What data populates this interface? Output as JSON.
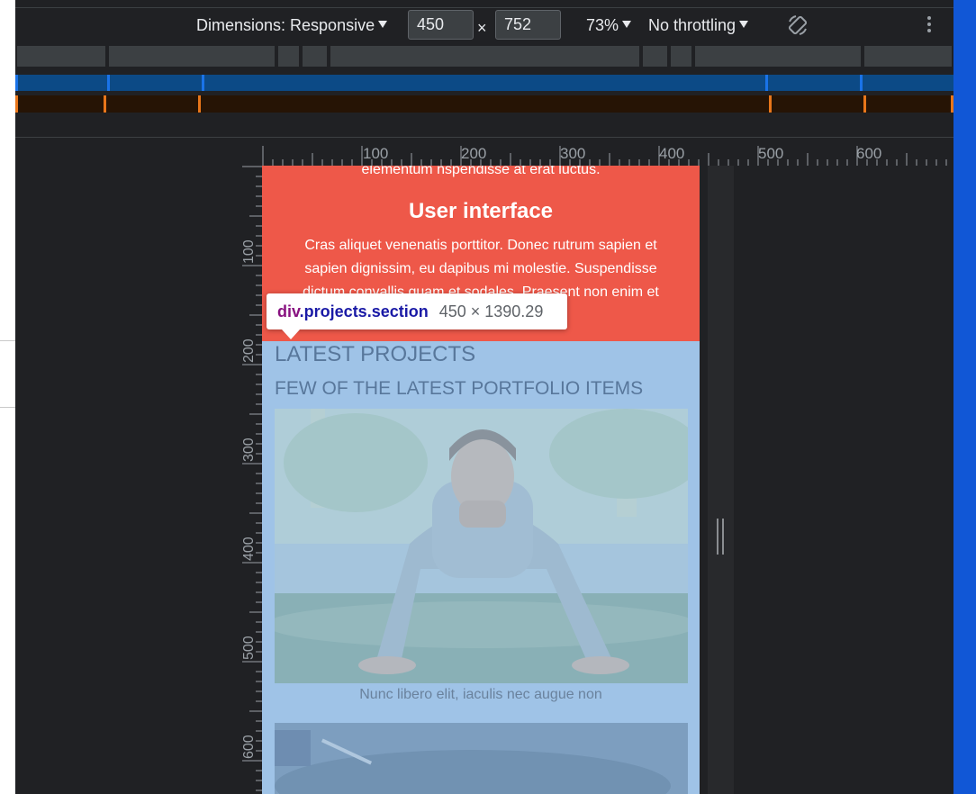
{
  "toolbar": {
    "dimensions_label": "Dimensions: Responsive",
    "width_value": "450",
    "height_value": "752",
    "times_symbol": "×",
    "zoom_label": "73%",
    "throttling_label": "No throttling"
  },
  "rulers": {
    "horizontal_labels": [
      "100",
      "200",
      "300",
      "400",
      "500",
      "600"
    ],
    "vertical_labels": [
      "100",
      "200",
      "300",
      "400",
      "500",
      "600"
    ]
  },
  "page": {
    "red_section": {
      "partial_text": "elementum nspendisse at erat luctus.",
      "title": "User interface",
      "text": "Cras aliquet venenatis porttitor. Donec rutrum sapien et sapien dignissim, eu dapibus mi molestie. Suspendisse dictum convallis quam et sodales. Praesent non enim et"
    },
    "projects_section": {
      "title": "LATEST PROJECTS",
      "subtitle": "FEW OF THE LATEST PORTFOLIO ITEMS",
      "caption": "Nunc libero elit, iaculis nec augue non"
    }
  },
  "tooltip": {
    "tag": "div",
    "classes": ".projects.section",
    "size": "450 × 1390.29"
  },
  "colors": {
    "devtools_bg": "#202124",
    "red_section": "#ee5849",
    "highlight_overlay": "#9fc3e7",
    "tooltip_tag": "#881280",
    "tooltip_class": "#1a1aa6",
    "right_edge_blue": "#1157d6"
  }
}
